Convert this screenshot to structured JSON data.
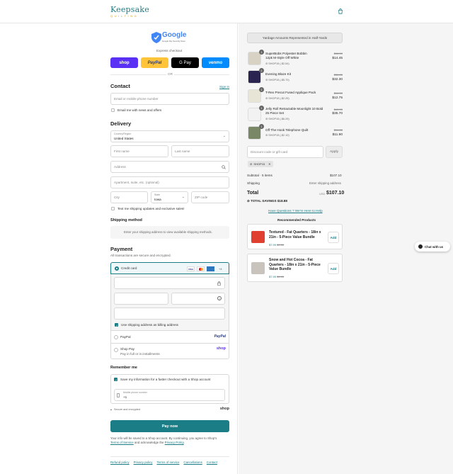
{
  "brand": {
    "name": "Keepsake",
    "tagline": "QUILTING"
  },
  "google_badge": {
    "title": "Google",
    "sub": "Google Pay Security Store"
  },
  "express": {
    "label": "Express checkout",
    "shop": "shop",
    "paypal": "PayPal",
    "gpay": "G Pay",
    "venmo": "venmo",
    "or": "OR"
  },
  "contact": {
    "title": "Contact",
    "sign_in": "Sign in",
    "email_placeholder": "Email or mobile phone number",
    "newsletter": "Email me with news and offers"
  },
  "delivery": {
    "title": "Delivery",
    "country_label": "Country/Region",
    "country_value": "United States",
    "first_name": "First name",
    "last_name": "Last name",
    "address": "Address",
    "apartment": "Apartment, suite, etc. (optional)",
    "city": "City",
    "state_label": "State",
    "state_value": "Iowa",
    "zip": "ZIP code",
    "sms": "Text me shipping updates and exclusive sales!"
  },
  "shipping": {
    "title": "Shipping method",
    "note": "Enter your shipping address to view available shipping methods."
  },
  "payment": {
    "title": "Payment",
    "secure": "All transactions are secure and encrypted.",
    "credit_card": "Credit card",
    "more_cards": "+4",
    "billing_same": "Use shipping address as billing address",
    "paypal": "PayPal",
    "paypal_logo": "PayPal",
    "shop_pay": "Shop Pay",
    "shop_pay_sub": "Pay in full or in installments",
    "shop_logo": "shop"
  },
  "remember": {
    "title": "Remember me",
    "save_info": "Save my information for a faster checkout with a Shop account",
    "phone_label": "Mobile phone number",
    "phone_value": "+1",
    "secure": "Secure and encrypted",
    "shop": "shop"
  },
  "pay_now": "Pay now",
  "legal": {
    "text1": "Your info will be saved to a Shop account. By continuing, you agree to Shop's",
    "terms": "Terms of Service",
    "and": "and acknowledge the",
    "privacy": "Privacy Policy",
    "end": "."
  },
  "footer_links": [
    "Refund policy",
    "Privacy policy",
    "Terms of service",
    "Cancellations",
    "Contact"
  ],
  "cart": {
    "banner": "Yardage Amounts Represented in Half-Yards",
    "items": [
      {
        "qty": "1",
        "name": "SuperBobs Polyester Bobbin 12pk M-Style Off White",
        "disc": "SHOP15 (-$2.54)",
        "old": "$16.99",
        "new": "$14.45",
        "color": "#c9c0b0"
      },
      {
        "qty": "1",
        "name": "Evening Blaze Kit",
        "disc": "SHOP15 (-$5.70)",
        "old": "$38.00",
        "new": "$32.30",
        "color": "#2a2550"
      },
      {
        "qty": "1",
        "name": "T-Rex Precut Fused Applique Pack",
        "disc": "SHOP15 (-$2.25)",
        "old": "$14.99",
        "new": "$12.75",
        "color": "#7d9a4a"
      },
      {
        "qty": "1",
        "name": "Jelly Roll Retractable Moonlight 10 Bold 25 Piece Set",
        "disc": "SHOP15 (-$6.29)",
        "old": "$41.99",
        "new": "$35.70",
        "color": "#d13b78"
      },
      {
        "qty": "1",
        "name": "Off The Hook Telephone Quilt",
        "disc": "SHOP15 (-$2.10)",
        "old": "$14.00",
        "new": "$11.90",
        "color": "#6e7c63"
      }
    ],
    "discount_placeholder": "Discount code or gift card",
    "apply": "Apply",
    "code_tag": "SHOP15",
    "subtotal_label": "Subtotal · 5 items",
    "subtotal_value": "$107.10",
    "shipping_label": "Shipping",
    "shipping_value": "Enter shipping address",
    "total_label": "Total",
    "currency": "USD",
    "total_value": "$107.10",
    "savings": "TOTAL SAVINGS $18.88",
    "help": "Have Questions ? We're Here to Help",
    "rec_title": "Recommended Products",
    "recs": [
      {
        "name": "Textured - Fat Quarters - 18in x 21in - 5-Piece Value Bundle",
        "price": "$7.99",
        "old": "$9.99",
        "add": "Add"
      },
      {
        "name": "Snow and Hot Cocoa - Fat Quarters - 18in x 21in - 5-Piece Value Bundle",
        "price": "$7.99",
        "old": "$9.99",
        "add": "Add"
      }
    ]
  },
  "chat": {
    "label": "Chat with us"
  },
  "colors": {
    "accent": "#1b7d86",
    "shop": "#5a31f4",
    "paypal": "#ffc439",
    "venmo": "#008cff"
  }
}
